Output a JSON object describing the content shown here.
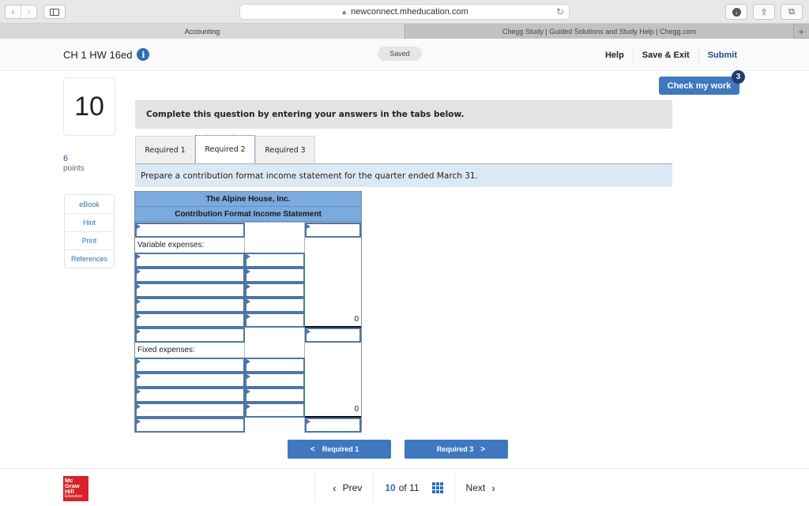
{
  "browser": {
    "url": "newconnect.mheducation.com",
    "tabs": [
      {
        "label": "Accounting",
        "active": true
      },
      {
        "label": "Chegg Study | Guided Solutions and Study Help | Chegg.com",
        "active": false
      }
    ],
    "icons": {
      "back": "‹",
      "forward": "›",
      "reload": "↻",
      "lock": "🔒",
      "share": "⇧",
      "tabs": "⧉",
      "new_tab": "+",
      "download": "↓"
    }
  },
  "header": {
    "assignment_title": "CH 1 HW 16ed",
    "info_glyph": "i",
    "save_status": "Saved",
    "links": {
      "help": "Help",
      "save_exit": "Save & Exit",
      "submit": "Submit"
    },
    "check_my_work": {
      "label": "Check my work",
      "remaining": "3"
    }
  },
  "question": {
    "number": "10",
    "points_value": "6",
    "points_label": "points",
    "side_links": [
      "eBook",
      "Hint",
      "Print",
      "References"
    ],
    "instructions": "Complete this question by entering your answers in the tabs below.",
    "tabs": [
      {
        "label": "Required 1",
        "active": false
      },
      {
        "label": "Required 2",
        "active": true
      },
      {
        "label": "Required 3",
        "active": false
      }
    ],
    "prompt": "Prepare a contribution format income statement for the quarter ended March 31."
  },
  "statement": {
    "company": "The Alpine House, Inc.",
    "title": "Contribution Format Income Statement",
    "rows": [
      {
        "c1": "",
        "c2": "",
        "c3": ""
      },
      {
        "c1": "Variable expenses:",
        "c2": "",
        "c3": ""
      },
      {
        "c1": "",
        "c2": "",
        "c3": ""
      },
      {
        "c1": "",
        "c2": "",
        "c3": ""
      },
      {
        "c1": "",
        "c2": "",
        "c3": ""
      },
      {
        "c1": "",
        "c2": "",
        "c3": ""
      },
      {
        "c1": "",
        "c2": "",
        "c3": "0"
      },
      {
        "c1": "",
        "c2": "",
        "c3": ""
      },
      {
        "c1": "Fixed expenses:",
        "c2": "",
        "c3": ""
      },
      {
        "c1": "",
        "c2": "",
        "c3": ""
      },
      {
        "c1": "",
        "c2": "",
        "c3": ""
      },
      {
        "c1": "",
        "c2": "",
        "c3": ""
      },
      {
        "c1": "",
        "c2": "",
        "c3": "0"
      },
      {
        "c1": "",
        "c2": "",
        "c3": ""
      }
    ]
  },
  "req_nav": {
    "prev": {
      "label": "Required 1",
      "chevron": "<"
    },
    "next": {
      "label": "Required 3",
      "chevron": ">"
    }
  },
  "footer": {
    "logo_lines": [
      "Mc",
      "Graw",
      "Hill",
      "Education"
    ],
    "prev_label": "Prev",
    "next_label": "Next",
    "current_page": "10",
    "of_label": "of",
    "total_pages": "11",
    "prev_chevron": "‹",
    "next_chevron": "›"
  }
}
